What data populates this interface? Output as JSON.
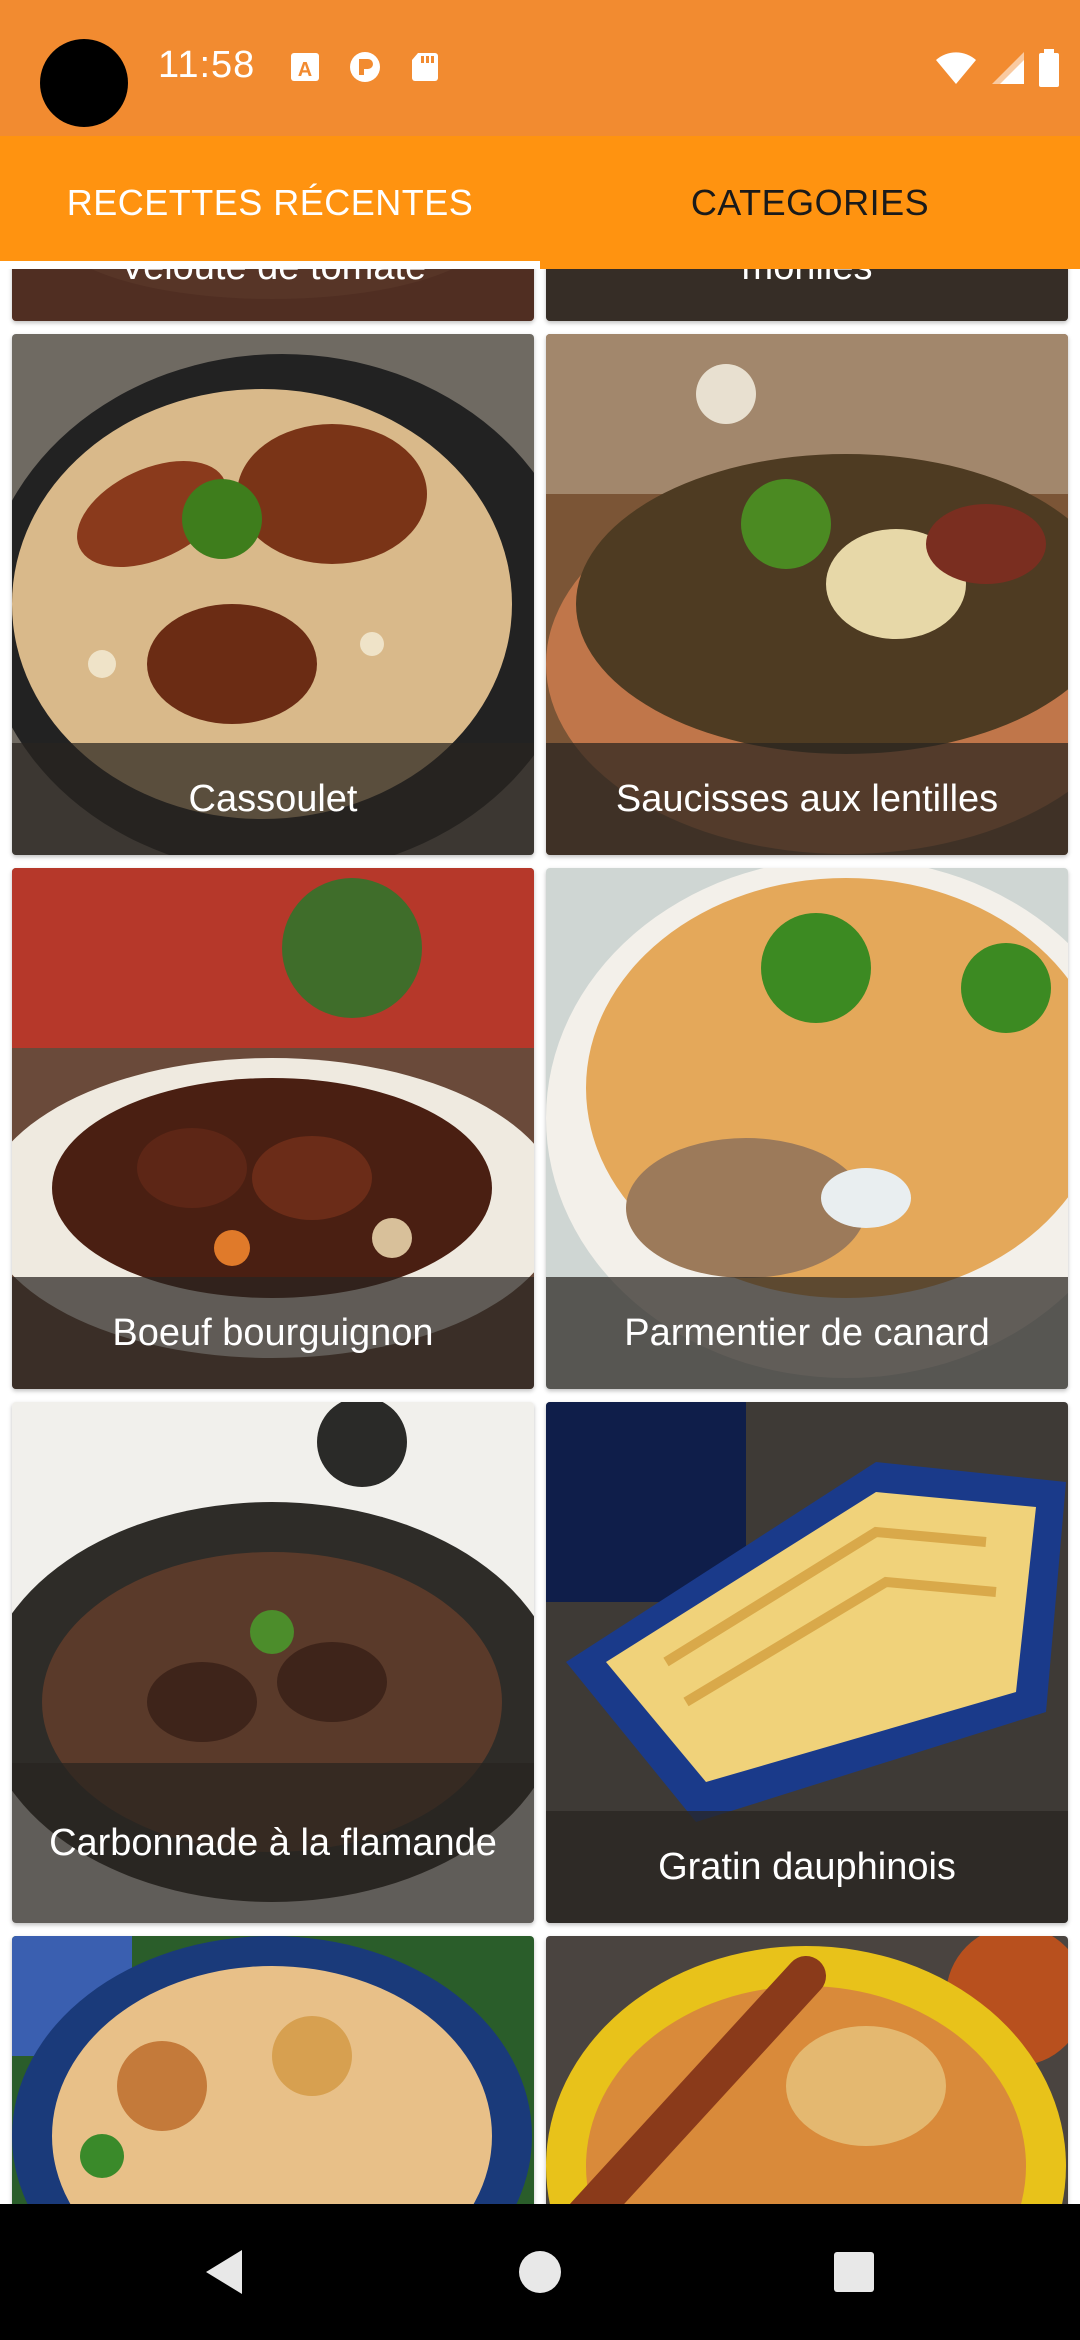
{
  "status_bar": {
    "time": "11:58",
    "icons": [
      "camera-hole",
      "a-notification-icon",
      "p-notification-icon",
      "sd-card-icon",
      "wifi-icon",
      "signal-icon",
      "battery-icon"
    ]
  },
  "tabs": [
    {
      "label": "RECETTES RÉCENTES",
      "selected": true
    },
    {
      "label": "CATEGORIES",
      "selected": false
    }
  ],
  "recipes": [
    {
      "title": "Velouté de tomate",
      "image": "tomato-soup-photo"
    },
    {
      "title": "morilles",
      "image": "morilles-photo"
    },
    {
      "title": "Cassoulet",
      "image": "cassoulet-photo"
    },
    {
      "title": "Saucisses aux lentilles",
      "image": "sausage-lentils-photo"
    },
    {
      "title": "Boeuf bourguignon",
      "image": "beef-stew-photo"
    },
    {
      "title": "Parmentier de canard",
      "image": "duck-parmentier-photo"
    },
    {
      "title": "Carbonnade à la flamande",
      "image": "carbonnade-photo"
    },
    {
      "title": "Gratin dauphinois",
      "image": "gratin-photo"
    },
    {
      "title": "",
      "image": "moussaka-photo"
    },
    {
      "title": "",
      "image": "couscous-photo"
    }
  ],
  "colors": {
    "status_bar": "#f28b30",
    "tab_bar": "#ff9310",
    "tab_selected_text": "#ffffff",
    "tab_unselected_text": "#1a1a1a",
    "caption_overlay": "rgba(40,36,32,0.72)"
  },
  "nav_bar": {
    "buttons": [
      "back-icon",
      "home-icon",
      "recents-icon"
    ]
  }
}
